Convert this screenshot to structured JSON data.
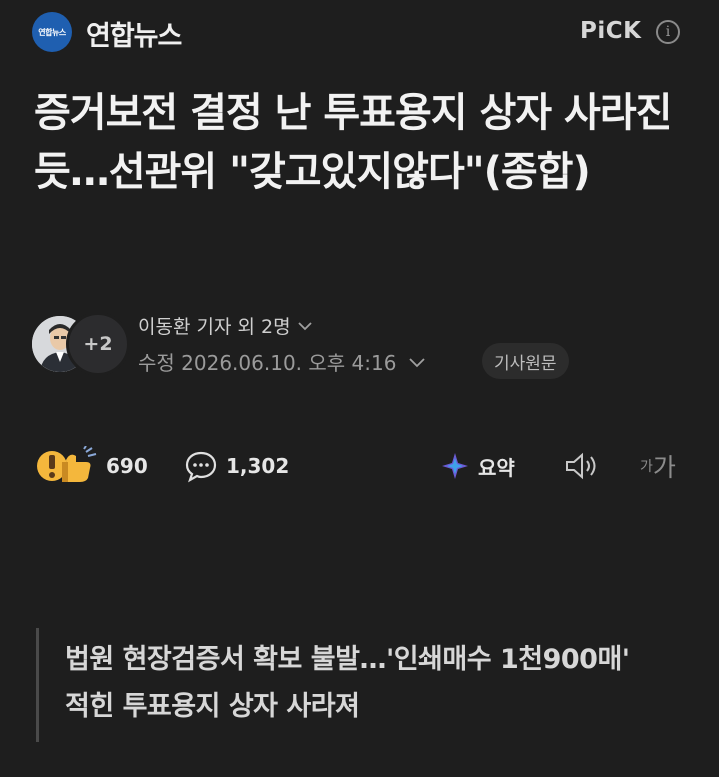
{
  "header": {
    "press_logo_text": "연합뉴스",
    "press_name": "연합뉴스",
    "pick_label": "PiCK",
    "info_icon": "info-icon",
    "logo_color": "#1f5fb0"
  },
  "article": {
    "headline": "증거보전 결정 난 투표용지 상자 사라진 듯…선관위 \"갖고있지않다\"(종합)",
    "author": "이동환 기자 외 2명",
    "more_authors_badge": "+2",
    "date_label": "수정 2026.06.10. 오후 4:16",
    "original_button": "기사원문"
  },
  "actions": {
    "reaction_count": "690",
    "comment_count": "1,302",
    "summary_label": "요약",
    "font_small": "가",
    "font_big": "가"
  },
  "subheadline": "법원 현장검증서 확보 불발…'인쇄매수 1천900매' 적힌 투표용지 상자 사라져"
}
